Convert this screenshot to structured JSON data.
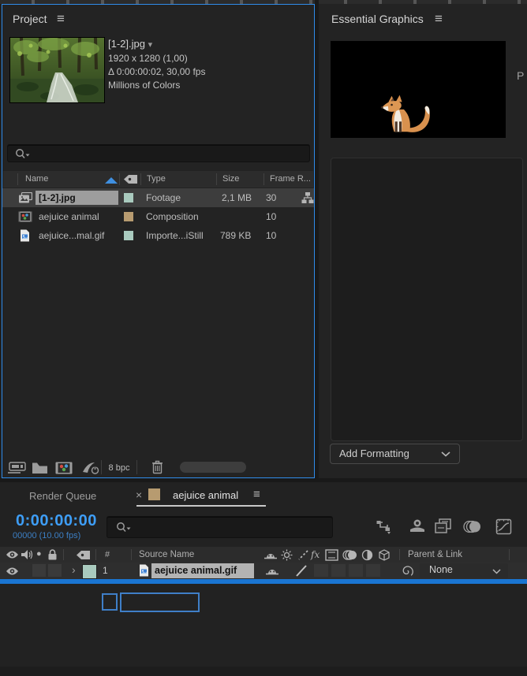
{
  "app": {
    "accent_blue": "#2f8ceb",
    "selection_blue": "#1a75d2",
    "timecode_blue": "#3e9ef7"
  },
  "glyphs": {
    "menu": "≡",
    "caret_down": "▾",
    "close": "×",
    "chevron_right": "›",
    "solo_dot": "●",
    "fx": "fx",
    "delta": "Δ"
  },
  "project_panel": {
    "title": "Project",
    "preview": {
      "filename": "[1-2].jpg",
      "dimensions": "1920 x 1280 (1,00)",
      "timing": "Δ 0:00:00:02, 30,00 fps",
      "color_info": "Millions of Colors"
    },
    "table": {
      "col_name": "Name",
      "col_type": "Type",
      "col_size": "Size",
      "col_frame_rate": "Frame R...",
      "rows": [
        {
          "name": "[1-2].jpg",
          "type": "Footage",
          "size": "2,1 MB",
          "frame_rate": "30",
          "label_color": "#a9cabe"
        },
        {
          "name": "aejuice animal",
          "type": "Composition",
          "size": "",
          "frame_rate": "10",
          "label_color": "#b79b70"
        },
        {
          "name": "aejuice...mal.gif",
          "type": "Importe...iStill",
          "size": "789 KB",
          "frame_rate": "10",
          "label_color": "#a9cabe"
        }
      ]
    },
    "footer": {
      "bit_depth": "8 bpc"
    }
  },
  "essential_graphics": {
    "title": "Essential Graphics",
    "add_formatting": "Add Formatting",
    "clipped_panel_letter": "P"
  },
  "timeline_panel": {
    "tab_render_queue": "Render Queue",
    "tab_active": "aejuice animal",
    "tab_label_color": "#b79b70",
    "timecode": "0:00:00:00",
    "frame_counter": "00000 (10.00 fps)",
    "header": {
      "hash": "#",
      "source_name": "Source Name",
      "parent_link": "Parent & Link"
    },
    "layer": {
      "index": "1",
      "name": "aejuice animal.gif",
      "label_color": "#a9cabe",
      "parent_value": "None"
    }
  }
}
